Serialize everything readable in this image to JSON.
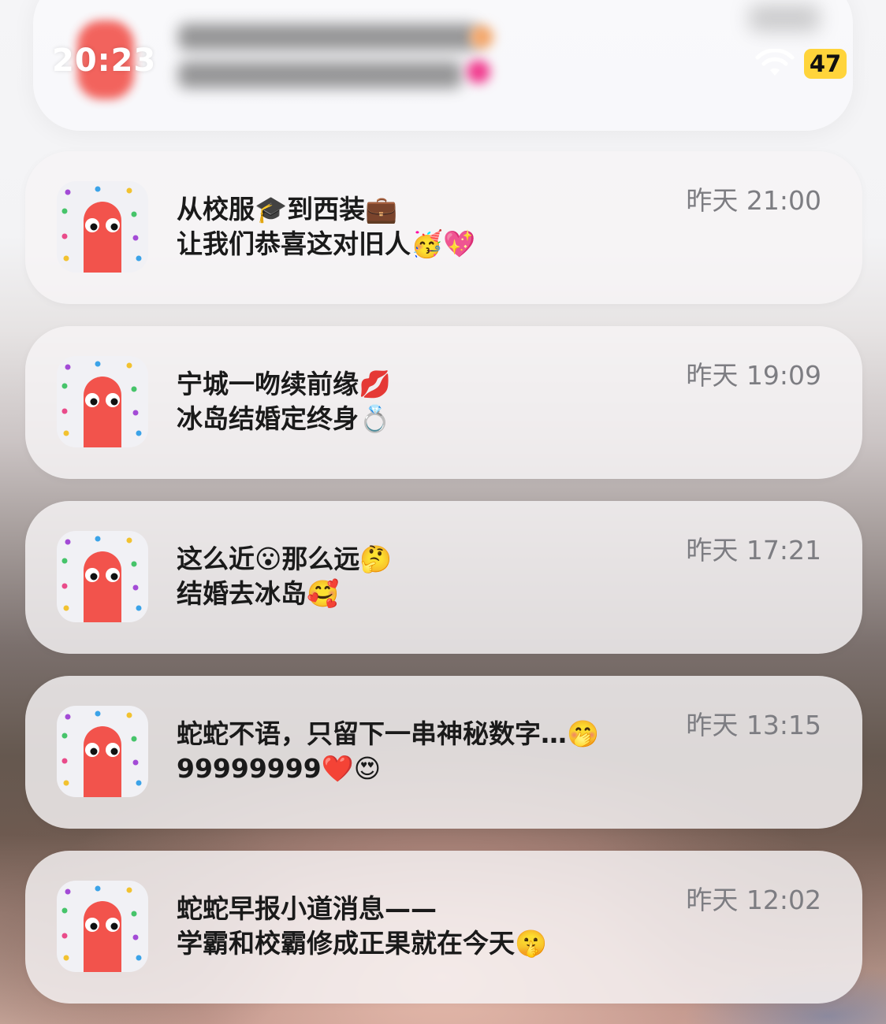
{
  "status_bar": {
    "time": "20:23",
    "battery": "47",
    "wifi_icon": "wifi-icon"
  },
  "notifications": [
    {
      "app_icon": "snake-app-icon",
      "line1": "从校服🎓到西装💼",
      "line2": "让我们恭喜这对旧人🥳💖",
      "time": "昨天 21:00"
    },
    {
      "app_icon": "snake-app-icon",
      "line1": "宁城一吻续前缘💋",
      "line2": "冰岛结婚定终身💍",
      "time": "昨天 19:09"
    },
    {
      "app_icon": "snake-app-icon",
      "line1": "这么近😮那么远🤔",
      "line2": "结婚去冰岛🥰",
      "time": "昨天 17:21"
    },
    {
      "app_icon": "snake-app-icon",
      "line1": "蛇蛇不语，只留下一串神秘数字…🤭",
      "line2": "99999999❤️😍",
      "time": "昨天 13:15"
    },
    {
      "app_icon": "snake-app-icon",
      "line1": "蛇蛇早报小道消息——",
      "line2": "学霸和校霸修成正果就在今天🤫",
      "time": "昨天 12:02"
    }
  ],
  "colors": {
    "icon_red": "#f2534c",
    "battery_yellow": "#ffd43b",
    "time_gray": "#7d7d82"
  }
}
